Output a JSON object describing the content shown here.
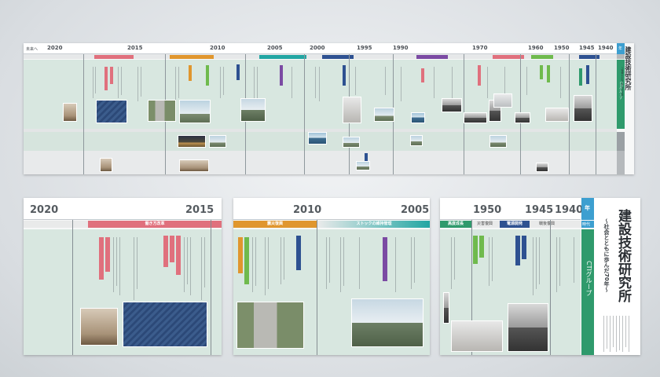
{
  "timeline": {
    "header_left": "未来へ",
    "years": [
      "2020",
      "2015",
      "2010",
      "2005",
      "2000",
      "1995",
      "1990",
      "1970",
      "1960",
      "1950",
      "1945",
      "1940"
    ],
    "side_year_label": "年"
  },
  "title": {
    "main": "建設技術研究所",
    "sub": "～社会とともに歩んだ70年～"
  },
  "side": {
    "era_label": "時代",
    "group_label": "CTIグループ"
  },
  "panel_a": {
    "years": [
      "2020",
      "2015"
    ],
    "era": "働き方改革"
  },
  "panel_b": {
    "years": [
      "2010",
      "2005"
    ],
    "eras": [
      "震災復興",
      "ストックの維持管理"
    ]
  },
  "panel_c": {
    "years": [
      "1950",
      "1945",
      "1940"
    ],
    "year_label": "年",
    "eras": [
      "高度成長",
      "災害復興",
      "電源開発",
      "戦後復興"
    ],
    "era_label": "時代",
    "group_label": "CTIグループ",
    "title": "建設技術研究所",
    "subtitle": "～社会とともに歩んだ70年～"
  },
  "colors": {
    "accent_blue": "#3d9fd0",
    "accent_green": "#2f9a6c",
    "tag_pink": "#e0707d",
    "tag_orange": "#e0962e",
    "tag_teal": "#22a6a3",
    "tag_purple": "#7b4aa3",
    "tag_navy": "#2e5191",
    "tag_green": "#6fba4d"
  }
}
